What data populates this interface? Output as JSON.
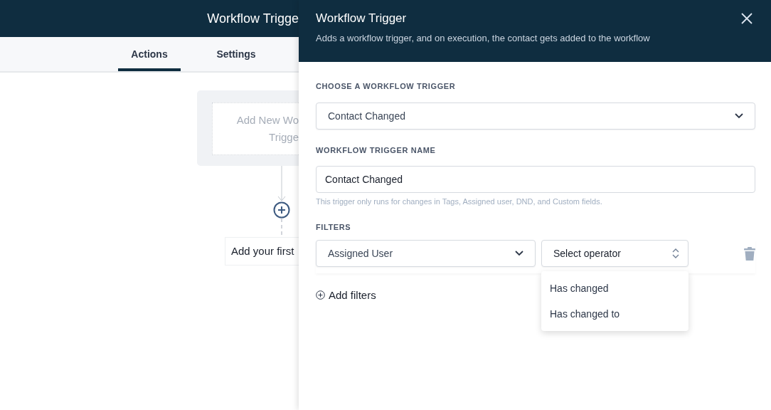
{
  "builder": {
    "title": "Workflow Trigge",
    "tabs": [
      {
        "label": "Actions",
        "selected": true
      },
      {
        "label": "Settings",
        "selected": false
      }
    ],
    "trigger_card": {
      "lines": [
        "Add New Wo",
        "Trigge"
      ]
    },
    "first_action": "Add your first"
  },
  "panel": {
    "title": "Workflow Trigger",
    "subtitle": "Adds a workflow trigger, and on execution, the contact gets added to the workflow",
    "trigger_select": {
      "label": "CHOOSE A WORKFLOW TRIGGER",
      "value": "Contact Changed"
    },
    "name_field": {
      "label": "WORKFLOW TRIGGER NAME",
      "value": "Contact Changed",
      "help": "This trigger only runs for changes in Tags, Assigned user, DND, and Custom fields."
    },
    "filters": {
      "label": "FILTERS",
      "rows": [
        {
          "field": "Assigned User",
          "operator": "Select operator",
          "operator_open": true,
          "options": [
            "Has changed",
            "Has changed to"
          ]
        }
      ],
      "add_button": "Add filters"
    }
  }
}
